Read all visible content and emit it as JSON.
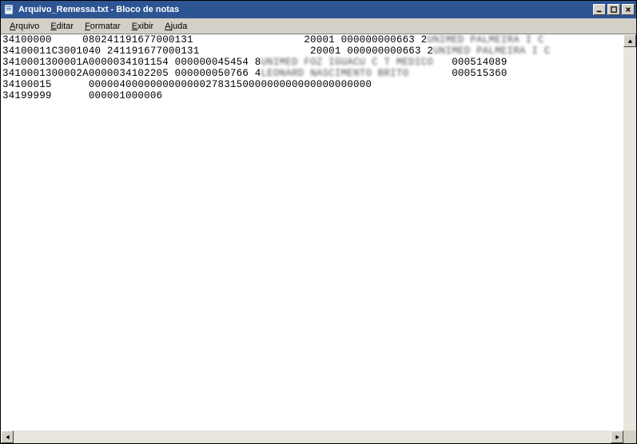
{
  "window": {
    "title": "Arquivo_Remessa.txt - Bloco de notas"
  },
  "menu": {
    "arquivo": "Arquivo",
    "editar": "Editar",
    "formatar": "Formatar",
    "exibir": "Exibir",
    "ajuda": "Ajuda"
  },
  "content": {
    "lines": [
      {
        "plain": "34100000     080241191677000131                  20001 000000000663 2",
        "blur": "UNIMED PALMEIRA I C "
      },
      {
        "plain": "34100011C3001040 241191677000131                  20001 000000000663 2",
        "blur": "UNIMED PALMEIRA I C "
      },
      {
        "plain": "3410001300001A0000034101154 000000045454 8",
        "blur": "UNIMED FOZ IGUACU C T MEDICO   ",
        "tail": "000514089"
      },
      {
        "plain": "3410001300002A0000034102205 000000050766 4",
        "blur": "LEONARD NASCIMENTO BRITO       ",
        "tail": "000515360"
      },
      {
        "plain": "34100015      0000040000000000000278315000000000000000000000",
        "blur": "",
        "tail": ""
      },
      {
        "plain": "34199999      000001000006",
        "blur": "",
        "tail": ""
      }
    ]
  }
}
